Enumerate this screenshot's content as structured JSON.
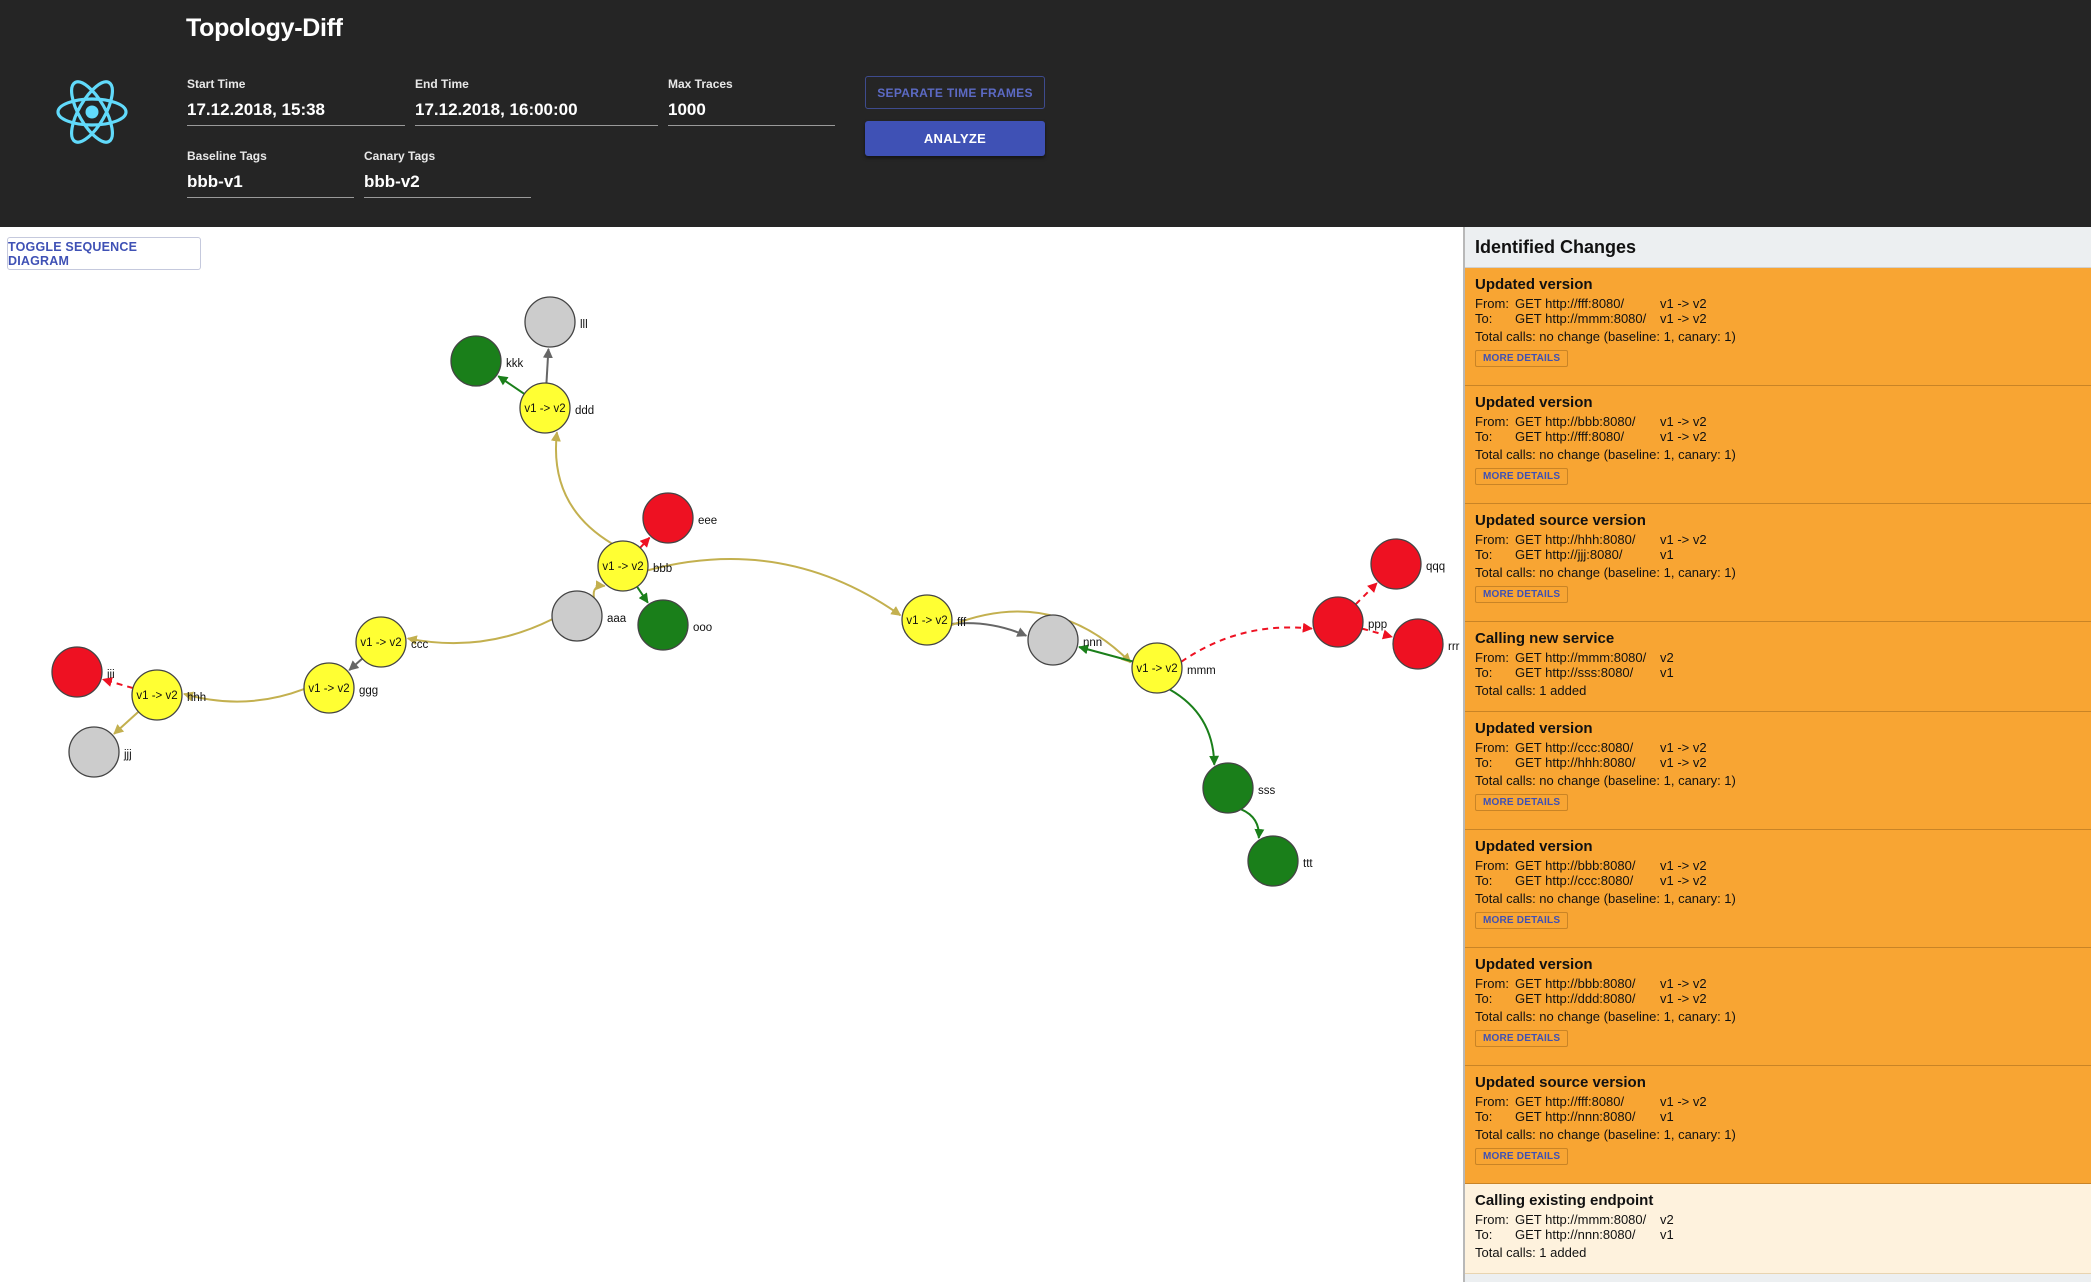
{
  "header": {
    "title": "Topology-Diff",
    "start_time": {
      "label": "Start Time",
      "value": "17.12.2018, 15:38"
    },
    "end_time": {
      "label": "End Time",
      "value": "17.12.2018, 16:00:00"
    },
    "max_traces": {
      "label": "Max Traces",
      "value": "1000"
    },
    "baseline_tags": {
      "label": "Baseline Tags",
      "value": "bbb-v1"
    },
    "canary_tags": {
      "label": "Canary Tags",
      "value": "bbb-v2"
    },
    "separate_button": "SEPARATE TIME FRAMES",
    "analyze_button": "ANALYZE"
  },
  "graph": {
    "toggle_button": "TOGGLE SEQUENCE DIAGRAM",
    "colors": {
      "changed": "#ffff33",
      "added": "#1a7f1a",
      "removed": "#ee1122",
      "unchanged": "#cccccc",
      "edge_changed": "#c3b04f",
      "edge_added": "#1a7f1a",
      "edge_removed": "#ee1122",
      "edge_unchanged": "#666666"
    },
    "nodes": [
      {
        "id": "aaa",
        "label": "aaa",
        "status": "unchanged",
        "version": ""
      },
      {
        "id": "bbb",
        "label": "bbb",
        "status": "changed",
        "version": "v1 -> v2"
      },
      {
        "id": "ccc",
        "label": "ccc",
        "status": "changed",
        "version": "v1 -> v2"
      },
      {
        "id": "ddd",
        "label": "ddd",
        "status": "changed",
        "version": "v1 -> v2"
      },
      {
        "id": "eee",
        "label": "eee",
        "status": "removed",
        "version": ""
      },
      {
        "id": "fff",
        "label": "fff",
        "status": "changed",
        "version": "v1 -> v2"
      },
      {
        "id": "ggg",
        "label": "ggg",
        "status": "changed",
        "version": "v1 -> v2"
      },
      {
        "id": "hhh",
        "label": "hhh",
        "status": "changed",
        "version": "v1 -> v2"
      },
      {
        "id": "iii",
        "label": "iii",
        "status": "removed",
        "version": ""
      },
      {
        "id": "jjj",
        "label": "jjj",
        "status": "unchanged",
        "version": ""
      },
      {
        "id": "kkk",
        "label": "kkk",
        "status": "added",
        "version": ""
      },
      {
        "id": "lll",
        "label": "lll",
        "status": "unchanged",
        "version": ""
      },
      {
        "id": "mmm",
        "label": "mmm",
        "status": "changed",
        "version": "v1 -> v2"
      },
      {
        "id": "nnn",
        "label": "nnn",
        "status": "unchanged",
        "version": ""
      },
      {
        "id": "ooo",
        "label": "ooo",
        "status": "added",
        "version": ""
      },
      {
        "id": "ppp",
        "label": "ppp",
        "status": "removed",
        "version": ""
      },
      {
        "id": "qqq",
        "label": "qqq",
        "status": "removed",
        "version": ""
      },
      {
        "id": "rrr",
        "label": "rrr",
        "status": "removed",
        "version": ""
      },
      {
        "id": "sss",
        "label": "sss",
        "status": "added",
        "version": ""
      },
      {
        "id": "ttt",
        "label": "ttt",
        "status": "added",
        "version": ""
      }
    ],
    "edges": [
      {
        "from": "aaa",
        "to": "bbb",
        "kind": "changed"
      },
      {
        "from": "aaa",
        "to": "ccc",
        "kind": "changed"
      },
      {
        "from": "bbb",
        "to": "ddd",
        "kind": "changed"
      },
      {
        "from": "bbb",
        "to": "eee",
        "kind": "removed"
      },
      {
        "from": "bbb",
        "to": "ooo",
        "kind": "added"
      },
      {
        "from": "bbb",
        "to": "fff",
        "kind": "changed"
      },
      {
        "from": "ccc",
        "to": "ggg",
        "kind": "unchanged"
      },
      {
        "from": "ggg",
        "to": "hhh",
        "kind": "changed"
      },
      {
        "from": "hhh",
        "to": "iii",
        "kind": "removed"
      },
      {
        "from": "hhh",
        "to": "jjj",
        "kind": "changed"
      },
      {
        "from": "ddd",
        "to": "kkk",
        "kind": "added"
      },
      {
        "from": "ddd",
        "to": "lll",
        "kind": "unchanged"
      },
      {
        "from": "fff",
        "to": "nnn",
        "kind": "unchanged"
      },
      {
        "from": "fff",
        "to": "mmm",
        "kind": "changed"
      },
      {
        "from": "mmm",
        "to": "nnn",
        "kind": "added"
      },
      {
        "from": "mmm",
        "to": "ppp",
        "kind": "removed"
      },
      {
        "from": "mmm",
        "to": "sss",
        "kind": "added"
      },
      {
        "from": "ppp",
        "to": "qqq",
        "kind": "removed"
      },
      {
        "from": "ppp",
        "to": "rrr",
        "kind": "removed"
      },
      {
        "from": "sss",
        "to": "ttt",
        "kind": "added"
      }
    ]
  },
  "changes": {
    "title": "Identified Changes",
    "more_details_label": "MORE DETAILS",
    "from_label": "From:",
    "to_label": "To:",
    "items": [
      {
        "title": "Updated version",
        "from_url": "GET http://fff:8080/",
        "from_ver": "v1 -> v2",
        "to_url": "GET http://mmm:8080/",
        "to_ver": "v1 -> v2",
        "calls": "Total calls: no change (baseline: 1, canary: 1)",
        "has_details": true,
        "light": false
      },
      {
        "title": "Updated version",
        "from_url": "GET http://bbb:8080/",
        "from_ver": "v1 -> v2",
        "to_url": "GET http://fff:8080/",
        "to_ver": "v1 -> v2",
        "calls": "Total calls: no change (baseline: 1, canary: 1)",
        "has_details": true,
        "light": false
      },
      {
        "title": "Updated source version",
        "from_url": "GET http://hhh:8080/",
        "from_ver": "v1 -> v2",
        "to_url": "GET http://jjj:8080/",
        "to_ver": "v1",
        "calls": "Total calls: no change (baseline: 1, canary: 1)",
        "has_details": true,
        "light": false
      },
      {
        "title": "Calling new service",
        "from_url": "GET http://mmm:8080/",
        "from_ver": "v2",
        "to_url": "GET http://sss:8080/",
        "to_ver": "v1",
        "calls": "Total calls: 1 added",
        "has_details": false,
        "light": false
      },
      {
        "title": "Updated version",
        "from_url": "GET http://ccc:8080/",
        "from_ver": "v1 -> v2",
        "to_url": "GET http://hhh:8080/",
        "to_ver": "v1 -> v2",
        "calls": "Total calls: no change (baseline: 1, canary: 1)",
        "has_details": true,
        "light": false
      },
      {
        "title": "Updated version",
        "from_url": "GET http://bbb:8080/",
        "from_ver": "v1 -> v2",
        "to_url": "GET http://ccc:8080/",
        "to_ver": "v1 -> v2",
        "calls": "Total calls: no change (baseline: 1, canary: 1)",
        "has_details": true,
        "light": false
      },
      {
        "title": "Updated version",
        "from_url": "GET http://bbb:8080/",
        "from_ver": "v1 -> v2",
        "to_url": "GET http://ddd:8080/",
        "to_ver": "v1 -> v2",
        "calls": "Total calls: no change (baseline: 1, canary: 1)",
        "has_details": true,
        "light": false
      },
      {
        "title": "Updated source version",
        "from_url": "GET http://fff:8080/",
        "from_ver": "v1 -> v2",
        "to_url": "GET http://nnn:8080/",
        "to_ver": "v1",
        "calls": "Total calls: no change (baseline: 1, canary: 1)",
        "has_details": true,
        "light": false
      },
      {
        "title": "Calling existing endpoint",
        "from_url": "GET http://mmm:8080/",
        "from_ver": "v2",
        "to_url": "GET http://nnn:8080/",
        "to_ver": "v1",
        "calls": "Total calls: 1 added",
        "has_details": false,
        "light": true
      }
    ]
  }
}
